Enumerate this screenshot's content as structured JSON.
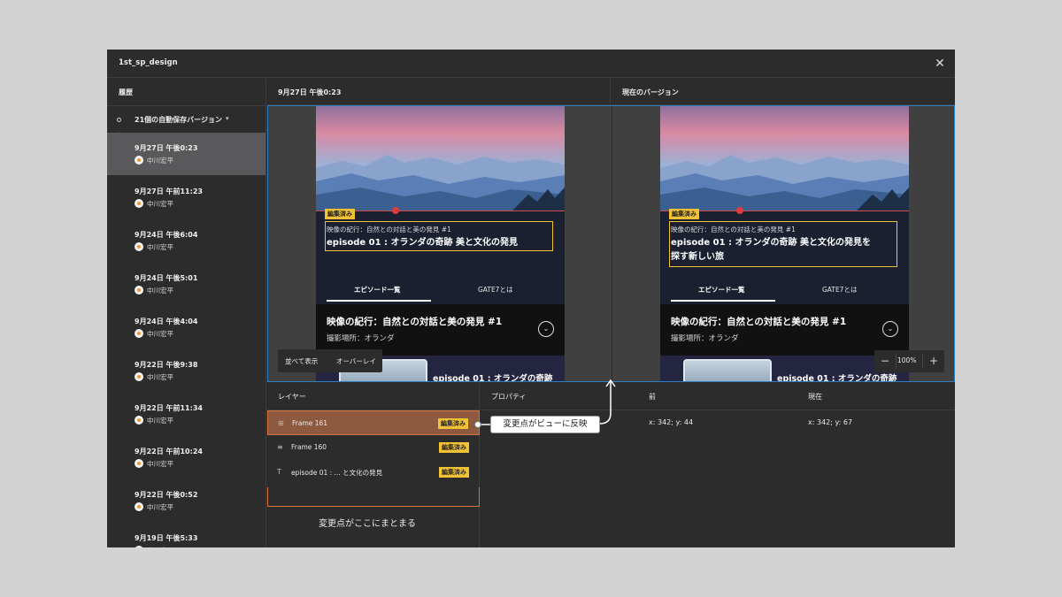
{
  "window": {
    "title": "1st_sp_design",
    "close_label": "✕"
  },
  "sidebar": {
    "header": "履歴",
    "group_label": "21個の自動保存バージョン",
    "items": [
      {
        "date": "9月27日 午後0:23",
        "user": "中川宏平"
      },
      {
        "date": "9月27日 午前11:23",
        "user": "中川宏平"
      },
      {
        "date": "9月24日 午後6:04",
        "user": "中川宏平"
      },
      {
        "date": "9月24日 午後5:01",
        "user": "中川宏平"
      },
      {
        "date": "9月24日 午後4:04",
        "user": "中川宏平"
      },
      {
        "date": "9月22日 午後9:38",
        "user": "中川宏平"
      },
      {
        "date": "9月22日 午前11:34",
        "user": "中川宏平"
      },
      {
        "date": "9月22日 午前10:24",
        "user": "中川宏平"
      },
      {
        "date": "9月22日 午後0:52",
        "user": "中川宏平"
      },
      {
        "date": "9月19日 午後5:33",
        "user": "中川宏平"
      }
    ]
  },
  "compare": {
    "left_header": "9月27日 午後0:23",
    "right_header": "現在のバージョン",
    "left": {
      "tag": "編集済み",
      "subtitle": "映像の紀行：自然との対話と美の発見 #1",
      "title_lines": [
        "episode 01 : オランダの奇跡 美と文化の発見"
      ],
      "tabs": [
        "エピソード一覧",
        "GATE7とは"
      ],
      "card_title": "映像の紀行：自然との対話と美の発見 #1",
      "card_sub": "撮影場所：オランダ",
      "ep_row_title": "episode 01 : オランダの奇跡"
    },
    "right": {
      "tag": "編集済み",
      "subtitle": "映像の紀行：自然との対話と美の発見 #1",
      "title_lines": [
        "episode 01 : オランダの奇跡 美と文化の発見を",
        "探す新しい旅"
      ],
      "tabs": [
        "エピソード一覧",
        "GATE7とは"
      ],
      "card_title": "映像の紀行：自然との対話と美の発見 #1",
      "card_sub": "撮影場所：オランダ",
      "ep_row_title": "episode 01 : オランダの奇跡"
    },
    "view_modes": [
      "並べて表示",
      "オーバーレイ"
    ],
    "zoom": {
      "value": "100%",
      "minus": "−",
      "plus": "+"
    }
  },
  "layers": {
    "header": "レイヤー",
    "items": [
      {
        "name": "Frame 161",
        "badge": "編集済み",
        "icon": "frame-grid-icon",
        "glyph": "⊞"
      },
      {
        "name": "Frame 160",
        "badge": "編集済み",
        "icon": "frame-lines-icon",
        "glyph": "≡"
      },
      {
        "name": "episode 01 : ...  と文化の発見",
        "badge": "編集済み",
        "icon": "text-icon",
        "glyph": "T"
      }
    ],
    "annotation": "変更点がここにまとまる"
  },
  "properties": {
    "header": "プロパティ",
    "before_header": "前",
    "current_header": "現在",
    "before_value": "x: 342; y: 44",
    "current_value": "x: 342; y: 67"
  },
  "callout": {
    "text": "変更点がビューに反映"
  },
  "colors": {
    "accent_blue": "#2f7ec4",
    "badge_yellow": "#f3c134",
    "highlight_orange": "#d6743f"
  }
}
